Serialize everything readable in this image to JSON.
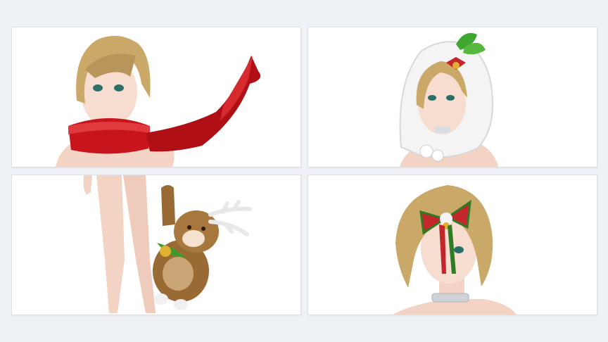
{
  "gallery": {
    "background": "#eef1f5",
    "items": [
      {
        "subject": "red-scarf",
        "accent": "#c8141c"
      },
      {
        "subject": "white-fur-hood-with-holly",
        "accent": "#f4f4f4"
      },
      {
        "subject": "reindeer-plush",
        "accent": "#9a6a35"
      },
      {
        "subject": "holiday-bow-hair-clip",
        "accent": "#c3262b"
      }
    ]
  }
}
